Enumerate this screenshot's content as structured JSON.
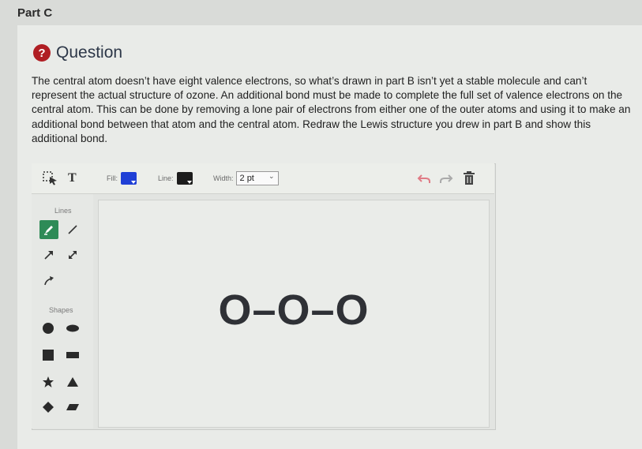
{
  "part": {
    "title": "Part C"
  },
  "question": {
    "heading": "Question",
    "icon": "question-circle-icon",
    "body": "The central atom doesn’t have eight valence electrons, so what’s drawn in part B isn’t yet a stable molecule and can’t represent the actual structure of ozone. An additional bond must be made to complete the full set of valence electrons on the central atom. This can be done by removing a lone pair of electrons from either one of the outer atoms and using it to make an additional bond between that atom and the central atom. Redraw the Lewis structure you drew in part B and show this additional bond."
  },
  "toolbar": {
    "fill_label": "Fill:",
    "fill_color": "#1f3fd6",
    "line_label": "Line:",
    "line_color": "#1c1c1c",
    "width_label": "Width:",
    "width_value": "2 pt",
    "text_tool": "T"
  },
  "palette": {
    "lines_label": "Lines",
    "shapes_label": "Shapes",
    "active_color": "#2e8b57"
  },
  "canvas": {
    "molecule": "O–O–O"
  }
}
